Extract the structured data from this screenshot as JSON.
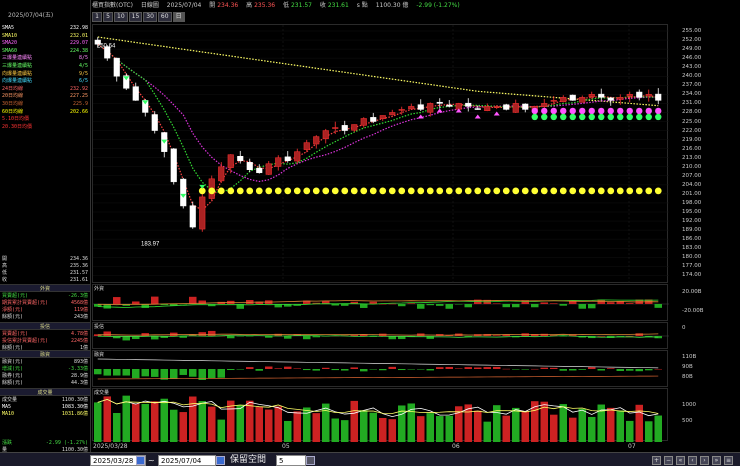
{
  "header": {
    "title": "櫃買指數(OTC)",
    "period": "日線圖",
    "date": "2025/07/04",
    "open_label": "開",
    "open": "234.36",
    "high_label": "高",
    "high": "235.36",
    "low_label": "低",
    "low": "231.57",
    "close_label": "收",
    "close": "231.61",
    "unit": "s 點",
    "volume": "1100.30 億",
    "change": "-2.99 (-1.27%)"
  },
  "periods": [
    "1",
    "5",
    "10",
    "15",
    "30",
    "60",
    "日"
  ],
  "active_period": "日",
  "left_panel": {
    "date": "2025/07/04(五)",
    "ma_rows": [
      {
        "label": "SMA5",
        "value": "232.98",
        "color": "#ffffff"
      },
      {
        "label": "SMA10",
        "value": "232.01",
        "color": "#ffff66"
      },
      {
        "label": "SMA20",
        "value": "229.07",
        "color": "#ff66ff"
      },
      {
        "label": "SMA60",
        "value": "224.38",
        "color": "#66ff66"
      },
      {
        "label": "三爆量連續點",
        "value": "8/5",
        "color": "#ff88ff"
      },
      {
        "label": "三爆量連續點",
        "value": "4/5",
        "color": "#66ff66"
      },
      {
        "label": "向爆量連續點",
        "value": "9/5",
        "color": "#ffcc44"
      },
      {
        "label": "向爆量連續點",
        "value": "6/5",
        "color": "#44ddff"
      },
      {
        "label": "24日均線",
        "value": "232.92",
        "color": "#ff6666"
      },
      {
        "label": "20日均線",
        "value": "227.25",
        "color": "#ff9966"
      },
      {
        "label": "30日均線",
        "value": "225.9",
        "color": "#cc6633"
      },
      {
        "label": "60日均線",
        "value": "202.66",
        "color": "#ffff00"
      },
      {
        "label": "5.10日均價",
        "value": "",
        "color": "#ff3333"
      },
      {
        "label": "20.30日均價",
        "value": "",
        "color": "#ff3333"
      }
    ],
    "ohlc": [
      {
        "label": "開",
        "value": "234.36"
      },
      {
        "label": "高",
        "value": "235.36"
      },
      {
        "label": "低",
        "value": "231.57"
      },
      {
        "label": "收",
        "value": "231.61"
      }
    ],
    "sec1": {
      "title": "外資",
      "rows": [
        {
          "label": "買賣超(元)",
          "value": "-26.3億",
          "color": "#44dd44"
        },
        {
          "label": "期貨累計買賣超(元)",
          "value": "4568億",
          "color": "#ff6666"
        },
        {
          "label": "淨額(元)",
          "value": "119億",
          "color": "#ff6666"
        },
        {
          "label": "餘額(元)",
          "value": "243億",
          "color": "#dddddd"
        }
      ]
    },
    "sec2": {
      "title": "投信",
      "rows": [
        {
          "label": "買賣超(元)",
          "value": "4.78億",
          "color": "#ff6666"
        },
        {
          "label": "投信累計買賣超(元)",
          "value": "2245億",
          "color": "#ff6666"
        },
        {
          "label": "餘額(元)",
          "value": "1億",
          "color": "#dddddd"
        }
      ]
    },
    "sec3": {
      "title": "融資",
      "rows": [
        {
          "label": "融資(元)",
          "value": "893億",
          "color": "#dddddd"
        },
        {
          "label": "增減(元)",
          "value": "-3.33億",
          "color": "#44dd44"
        },
        {
          "label": "融券(元)",
          "value": "28.9億",
          "color": "#dddddd"
        },
        {
          "label": "餘額(元)",
          "value": "44.3億",
          "color": "#dddddd"
        }
      ]
    },
    "sec4": {
      "title": "成交量",
      "rows": [
        {
          "label": "成交量",
          "value": "1100.30億",
          "color": "#dddddd"
        },
        {
          "label": "MA5",
          "value": "1083.30億",
          "color": "#ffffff"
        },
        {
          "label": "MA10",
          "value": "1031.86億",
          "color": "#ffff66"
        }
      ]
    },
    "footer": [
      {
        "label": "漲跌",
        "value": "-2.99 (-1.27%)",
        "color": "#44dd44"
      },
      {
        "label": "量",
        "value": "1100.30億",
        "color": "#dddddd"
      }
    ]
  },
  "panels": {
    "foreign": "外資",
    "trust": "投信",
    "margin": "融資",
    "volume": "成交量"
  },
  "price_axis": [
    "255.00",
    "252.00",
    "249.00",
    "246.00",
    "243.00",
    "240.00",
    "237.00",
    "234.00",
    "231.00",
    "228.00",
    "225.00",
    "222.00",
    "219.00",
    "216.00",
    "213.00",
    "210.00",
    "207.00",
    "204.00",
    "201.00",
    "198.00",
    "195.00",
    "192.00",
    "189.00",
    "186.00",
    "183.00",
    "180.00",
    "177.00",
    "174.00"
  ],
  "annotations": {
    "high": "250.64",
    "low": "183.97"
  },
  "sub_axes": {
    "foreign": [
      "20.00B",
      "-20.00B"
    ],
    "trust": [
      "0"
    ],
    "margin": [
      "110B",
      "90B",
      "80B"
    ],
    "volume": [
      "1000",
      "500"
    ]
  },
  "x_labels": [
    "2025/03/28",
    "05",
    "06",
    "07"
  ],
  "bottom": {
    "from_date": "2025/03/28",
    "to_date": "2025/07/04",
    "separator": "~",
    "keep_label": "保留空間",
    "keep_value": "5"
  }
}
